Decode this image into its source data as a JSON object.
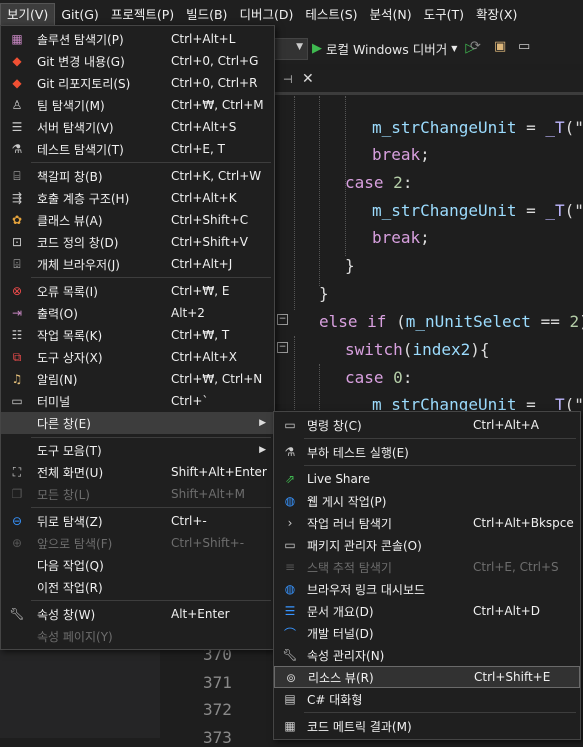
{
  "menubar": {
    "items": [
      "보기(V)",
      "Git(G)",
      "프로젝트(P)",
      "빌드(B)",
      "디버그(D)",
      "테스트(S)",
      "분석(N)",
      "도구(T)",
      "확장(X)"
    ]
  },
  "toolbar": {
    "run_label": "로컬 Windows 디버거"
  },
  "view_menu": {
    "items": [
      {
        "label": "솔루션 탐색기(P)",
        "shortcut": "Ctrl+Alt+L",
        "icon": "solution-explorer-icon"
      },
      {
        "label": "Git 변경 내용(G)",
        "shortcut": "Ctrl+0, Ctrl+G",
        "icon": "git-changes-icon"
      },
      {
        "label": "Git 리포지토리(S)",
        "shortcut": "Ctrl+0, Ctrl+R",
        "icon": "git-repository-icon"
      },
      {
        "label": "팀 탐색기(M)",
        "shortcut": "Ctrl+₩, Ctrl+M",
        "icon": "team-explorer-icon"
      },
      {
        "label": "서버 탐색기(V)",
        "shortcut": "Ctrl+Alt+S",
        "icon": "server-explorer-icon"
      },
      {
        "label": "테스트 탐색기(T)",
        "shortcut": "Ctrl+E, T",
        "icon": "test-explorer-icon"
      },
      {
        "label": "책갈피 창(B)",
        "shortcut": "Ctrl+K, Ctrl+W",
        "icon": "bookmark-window-icon"
      },
      {
        "label": "호출 계층 구조(H)",
        "shortcut": "Ctrl+Alt+K",
        "icon": "call-hierarchy-icon"
      },
      {
        "label": "클래스 뷰(A)",
        "shortcut": "Ctrl+Shift+C",
        "icon": "class-view-icon"
      },
      {
        "label": "코드 정의 창(D)",
        "shortcut": "Ctrl+Shift+V",
        "icon": "code-definition-icon"
      },
      {
        "label": "개체 브라우저(J)",
        "shortcut": "Ctrl+Alt+J",
        "icon": "object-browser-icon"
      },
      {
        "label": "오류 목록(I)",
        "shortcut": "Ctrl+₩, E",
        "icon": "error-list-icon"
      },
      {
        "label": "출력(O)",
        "shortcut": "Alt+2",
        "icon": "output-icon"
      },
      {
        "label": "작업 목록(K)",
        "shortcut": "Ctrl+₩, T",
        "icon": "task-list-icon"
      },
      {
        "label": "도구 상자(X)",
        "shortcut": "Ctrl+Alt+X",
        "icon": "toolbox-icon"
      },
      {
        "label": "알림(N)",
        "shortcut": "Ctrl+₩, Ctrl+N",
        "icon": "notifications-icon"
      },
      {
        "label": "터미널",
        "shortcut": "Ctrl+`",
        "icon": "terminal-icon"
      },
      {
        "label": "다른 창(E)",
        "shortcut": "",
        "icon": ""
      },
      {
        "label": "도구 모음(T)",
        "shortcut": "",
        "icon": ""
      },
      {
        "label": "전체 화면(U)",
        "shortcut": "Shift+Alt+Enter",
        "icon": "full-screen-icon"
      },
      {
        "label": "모든 창(L)",
        "shortcut": "Shift+Alt+M",
        "icon": "all-windows-icon"
      },
      {
        "label": "뒤로 탐색(Z)",
        "shortcut": "Ctrl+-",
        "icon": "navigate-back-icon"
      },
      {
        "label": "앞으로 탐색(F)",
        "shortcut": "Ctrl+Shift+-",
        "icon": "navigate-forward-icon"
      },
      {
        "label": "다음 작업(Q)",
        "shortcut": "",
        "icon": ""
      },
      {
        "label": "이전 작업(R)",
        "shortcut": "",
        "icon": ""
      },
      {
        "label": "속성 창(W)",
        "shortcut": "Alt+Enter",
        "icon": "wrench-icon"
      },
      {
        "label": "속성 페이지(Y)",
        "shortcut": "",
        "icon": ""
      }
    ]
  },
  "other_windows_menu": {
    "items": [
      {
        "label": "명령 창(C)",
        "shortcut": "Ctrl+Alt+A",
        "icon": "command-window-icon"
      },
      {
        "label": "부하 테스트 실행(E)",
        "shortcut": "",
        "icon": "load-test-icon"
      },
      {
        "label": "Live Share",
        "shortcut": "",
        "icon": "live-share-icon"
      },
      {
        "label": "웹 게시 작업(P)",
        "shortcut": "",
        "icon": "web-publish-icon"
      },
      {
        "label": "작업 러너 탐색기",
        "shortcut": "Ctrl+Alt+Bkspce",
        "icon": "task-runner-icon"
      },
      {
        "label": "패키지 관리자 콘솔(O)",
        "shortcut": "",
        "icon": "package-console-icon"
      },
      {
        "label": "스택 추적 탐색기",
        "shortcut": "Ctrl+E, Ctrl+S",
        "icon": "stack-trace-icon"
      },
      {
        "label": "브라우저 링크 대시보드",
        "shortcut": "",
        "icon": "browser-link-icon"
      },
      {
        "label": "문서 개요(D)",
        "shortcut": "Ctrl+Alt+D",
        "icon": "document-outline-icon"
      },
      {
        "label": "개발 터널(D)",
        "shortcut": "",
        "icon": "dev-tunnel-icon"
      },
      {
        "label": "속성 관리자(N)",
        "shortcut": "",
        "icon": "property-manager-icon"
      },
      {
        "label": "리소스 뷰(R)",
        "shortcut": "Ctrl+Shift+E",
        "icon": "resource-view-icon"
      },
      {
        "label": "C# 대화형",
        "shortcut": "",
        "icon": "csharp-interactive-icon"
      },
      {
        "label": "코드 메트릭 결과(M)",
        "shortcut": "",
        "icon": "code-metrics-icon"
      }
    ]
  },
  "code": {
    "lines": [
      {
        "parts": [
          [
            "id",
            "m_strChangeUnit"
          ],
          [
            "tx",
            " = "
          ],
          [
            "mac",
            "_T"
          ],
          [
            "tx",
            "(\"i"
          ]
        ]
      },
      {
        "parts": [
          [
            "kw",
            "break"
          ],
          [
            "tx",
            ";"
          ]
        ]
      },
      {
        "parts": [
          [
            "kw",
            "case"
          ],
          [
            "tx",
            " "
          ],
          [
            "num",
            "2"
          ],
          [
            "tx",
            ":"
          ]
        ]
      },
      {
        "parts": [
          [
            "id",
            "m_strChangeUnit"
          ],
          [
            "tx",
            " = "
          ],
          [
            "mac",
            "_T"
          ],
          [
            "tx",
            "(\"y"
          ]
        ]
      },
      {
        "parts": [
          [
            "kw",
            "break"
          ],
          [
            "tx",
            ";"
          ]
        ]
      },
      {
        "parts": [
          [
            "tx",
            "}"
          ]
        ]
      },
      {
        "parts": [
          [
            "tx",
            "}"
          ]
        ]
      },
      {
        "parts": [
          [
            "kw",
            "else if"
          ],
          [
            "tx",
            " ("
          ],
          [
            "id",
            "m_nUnitSelect"
          ],
          [
            "tx",
            " == "
          ],
          [
            "num",
            "2"
          ],
          [
            "tx",
            ") {"
          ]
        ]
      },
      {
        "parts": [
          [
            "kw",
            "switch"
          ],
          [
            "tx",
            "("
          ],
          [
            "id",
            "index2"
          ],
          [
            "tx",
            "){"
          ]
        ]
      },
      {
        "parts": [
          [
            "kw",
            "case"
          ],
          [
            "tx",
            " "
          ],
          [
            "num",
            "0"
          ],
          [
            "tx",
            ":"
          ]
        ]
      },
      {
        "parts": [
          [
            "id",
            "m_strChangeUnit"
          ],
          [
            "tx",
            " = "
          ],
          [
            "mac",
            "_T"
          ],
          [
            "tx",
            "(\"g"
          ]
        ]
      }
    ],
    "line_numbers": [
      "370",
      "371",
      "372",
      "373"
    ]
  }
}
